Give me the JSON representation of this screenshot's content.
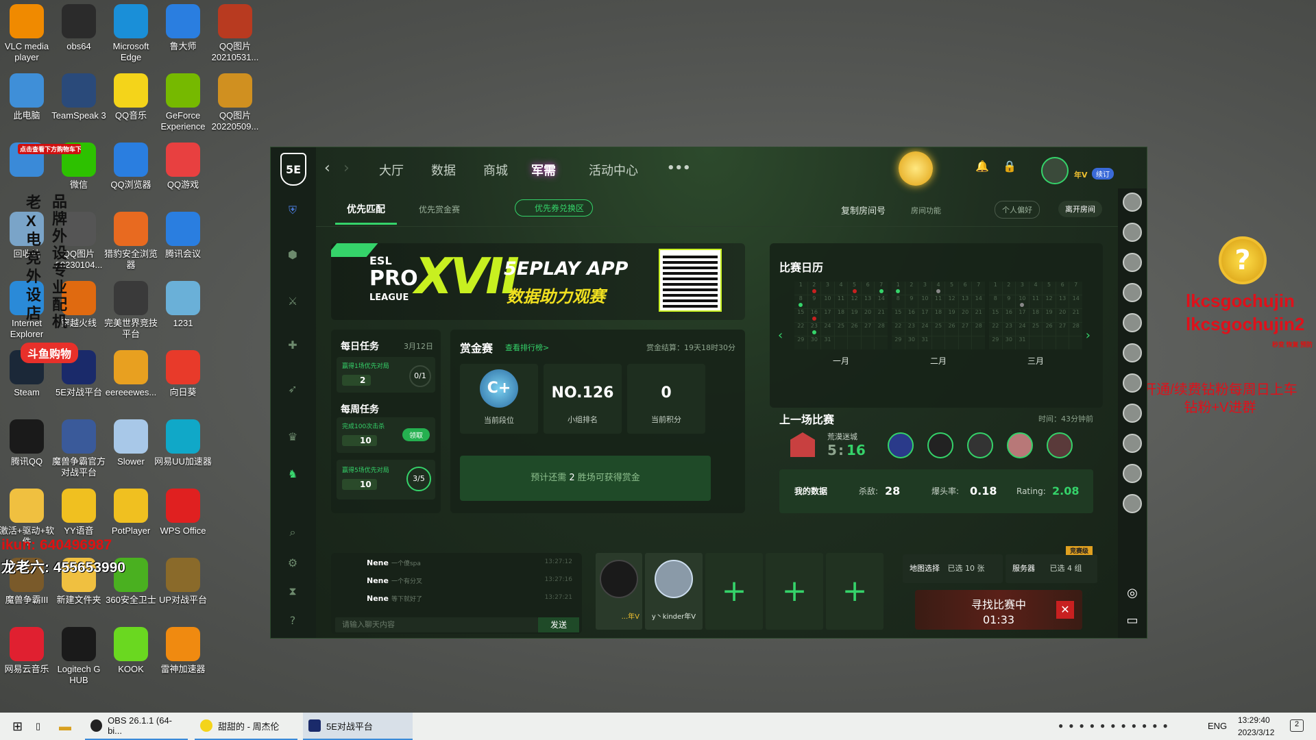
{
  "desktop_icons": [
    {
      "label": "VLC media player",
      "icon": "vlc-icon",
      "color": "#f08a00",
      "col": 0,
      "row": 0
    },
    {
      "label": "obs64",
      "icon": "obs-icon",
      "color": "#2b2b2b",
      "col": 1,
      "row": 0
    },
    {
      "label": "Microsoft Edge",
      "icon": "edge-icon",
      "color": "#1a8fd8",
      "col": 2,
      "row": 0
    },
    {
      "label": "鲁大师",
      "icon": "ludashi-icon",
      "color": "#2a7ee0",
      "col": 3,
      "row": 0
    },
    {
      "label": "QQ图片20210531...",
      "icon": "image-file-icon",
      "color": "#b83a20",
      "col": 4,
      "row": 0
    },
    {
      "label": "此电脑",
      "icon": "computer-icon",
      "color": "#3f8fd8",
      "col": 0,
      "row": 1
    },
    {
      "label": "TeamSpeak 3",
      "icon": "teamspeak-icon",
      "color": "#2a4a7a",
      "col": 1,
      "row": 1
    },
    {
      "label": "QQ音乐",
      "icon": "qqmusic-icon",
      "color": "#f4d41a",
      "col": 2,
      "row": 1
    },
    {
      "label": "GeForce Experience",
      "icon": "nvidia-icon",
      "color": "#76b900",
      "col": 3,
      "row": 1
    },
    {
      "label": "QQ图片20220509...",
      "icon": "image-file-icon",
      "color": "#d09020",
      "col": 4,
      "row": 1
    },
    {
      "label": "",
      "icon": "network-icon",
      "color": "#3a8ad8",
      "col": 0,
      "row": 2
    },
    {
      "label": "微信",
      "icon": "wechat-icon",
      "color": "#2dc100",
      "col": 1,
      "row": 2
    },
    {
      "label": "QQ浏览器",
      "icon": "qqbrowser-icon",
      "color": "#2a7ee0",
      "col": 2,
      "row": 2
    },
    {
      "label": "QQ游戏",
      "icon": "qqgame-icon",
      "color": "#e84040",
      "col": 3,
      "row": 2
    },
    {
      "label": "回收站",
      "icon": "recycle-bin-icon",
      "color": "#7aa4c8",
      "col": 0,
      "row": 3
    },
    {
      "label": "QQ图片20230104...",
      "icon": "image-file-icon",
      "color": "#555555",
      "col": 1,
      "row": 3
    },
    {
      "label": "猎豹安全浏览器",
      "icon": "liebao-icon",
      "color": "#e86a20",
      "col": 2,
      "row": 3
    },
    {
      "label": "腾讯会议",
      "icon": "tencent-meeting-icon",
      "color": "#2a7ee0",
      "col": 3,
      "row": 3
    },
    {
      "label": "Internet Explorer",
      "icon": "ie-icon",
      "color": "#2a8ad8",
      "col": 0,
      "row": 4
    },
    {
      "label": "穿越火线",
      "icon": "crossfire-icon",
      "color": "#e06a10",
      "col": 1,
      "row": 4
    },
    {
      "label": "完美世界竞技平台",
      "icon": "perfect-world-icon",
      "color": "#3a3a3a",
      "col": 2,
      "row": 4
    },
    {
      "label": "1231",
      "icon": "file-icon",
      "color": "#6ab0d8",
      "col": 3,
      "row": 4
    },
    {
      "label": "Steam",
      "icon": "steam-icon",
      "color": "#1b2838",
      "col": 0,
      "row": 5
    },
    {
      "label": "5E对战平台",
      "icon": "5e-icon",
      "color": "#1a2a6a",
      "col": 1,
      "row": 5
    },
    {
      "label": "eereeewes...",
      "icon": "gamepad-icon",
      "color": "#e8a020",
      "col": 2,
      "row": 5
    },
    {
      "label": "向日葵",
      "icon": "sunflower-icon",
      "color": "#e83a2a",
      "col": 3,
      "row": 5
    },
    {
      "label": "腾讯QQ",
      "icon": "qq-icon",
      "color": "#1a1a1a",
      "col": 0,
      "row": 6
    },
    {
      "label": "魔兽争霸官方对战平台",
      "icon": "warcraft-icon",
      "color": "#3a5a9a",
      "col": 1,
      "row": 6
    },
    {
      "label": "Slower",
      "icon": "slower-icon",
      "color": "#a8c8e8",
      "col": 2,
      "row": 6
    },
    {
      "label": "网易UU加速器",
      "icon": "uu-icon",
      "color": "#10a8c8",
      "col": 3,
      "row": 6
    },
    {
      "label": "激活+驱动+软件",
      "icon": "folder-icon",
      "color": "#f0c040",
      "col": 0,
      "row": 7
    },
    {
      "label": "YY语音",
      "icon": "yy-icon",
      "color": "#f0c020",
      "col": 1,
      "row": 7
    },
    {
      "label": "PotPlayer",
      "icon": "potplayer-icon",
      "color": "#f0c020",
      "col": 2,
      "row": 7
    },
    {
      "label": "WPS Office",
      "icon": "wps-icon",
      "color": "#e02020",
      "col": 3,
      "row": 7
    },
    {
      "label": "魔兽争霸III",
      "icon": "warcraft3-icon",
      "color": "#7a5a2a",
      "col": 0,
      "row": 8
    },
    {
      "label": "新建文件夹",
      "icon": "folder-icon",
      "color": "#f0c040",
      "col": 1,
      "row": 8
    },
    {
      "label": "360安全卫士",
      "icon": "360-icon",
      "color": "#4ab020",
      "col": 2,
      "row": 8
    },
    {
      "label": "UP对战平台",
      "icon": "up-icon",
      "color": "#8a6a2a",
      "col": 3,
      "row": 8
    },
    {
      "label": "网易云音乐",
      "icon": "netease-music-icon",
      "color": "#e02030",
      "col": 0,
      "row": 9
    },
    {
      "label": "Logitech G HUB",
      "icon": "logitech-icon",
      "color": "#1a1a1a",
      "col": 1,
      "row": 9
    },
    {
      "label": "KOOK",
      "icon": "kook-icon",
      "color": "#6ad820",
      "col": 2,
      "row": 9
    },
    {
      "label": "雷神加速器",
      "icon": "leishen-icon",
      "color": "#f08a10",
      "col": 3,
      "row": 9
    }
  ],
  "overlay": {
    "vertical_left": "老X电竞外设店",
    "vertical_right": "品牌外设专业配机",
    "shop_banner": "斗鱼购物",
    "ikun": "ikun: 640496987",
    "long": "龙老六: 455653990",
    "red_note": "点击查看下方购物车下单",
    "right_name1": "lkcsgochujin",
    "right_name2": "lkcsgochujin2",
    "right_small": "秒变 恢复 预防",
    "right_promo": "开通/续费钻粉每周日上车\n钻粉+V进群"
  },
  "app": {
    "nav": {
      "hall": "大厅",
      "data": "数据",
      "shop": "商城",
      "junxu": "军需",
      "activity": "活动中心",
      "more": "•••",
      "badge_user": "年V",
      "renew": "续订"
    },
    "subnav": {
      "tab1": "优先匹配",
      "tab2": "优先赏金赛",
      "coupon": "优先券兑换区",
      "copy_room": "复制房间号",
      "room_func": "房间功能",
      "pref": "个人偏好",
      "leave": "离开房间"
    },
    "banner": {
      "esl": "ESL",
      "pro": "PRO",
      "league": "LEAGUE",
      "xvii": "XVII",
      "line1": "5EPLAY APP",
      "line2": "数据助力观赛"
    },
    "tasks": {
      "daily_title": "每日任务",
      "date": "3月12日",
      "daily_desc": "赢得1场优先对局",
      "daily_reward": "2",
      "daily_progress": "0/1",
      "weekly_title": "每周任务",
      "w1_desc": "完成100次击杀",
      "w1_reward": "10",
      "w1_btn": "领取",
      "w2_desc": "赢得5场优先对局",
      "w2_reward": "10",
      "w2_progress": "3/5"
    },
    "bounty": {
      "title": "赏金赛",
      "rank_link": "查看排行榜>",
      "settle": "赏金结算：19天18时30分",
      "rank_label": "当前段位",
      "rank_icon": "C+",
      "group_rank": "NO.126",
      "group_label": "小组排名",
      "points": "0",
      "points_label": "当前积分",
      "hint_pre": "预计还需",
      "hint_num": "2",
      "hint_post": "胜场可获得赏金"
    },
    "calendar": {
      "title": "比赛日历",
      "months": [
        "一月",
        "二月",
        "三月"
      ]
    },
    "last": {
      "title": "上一场比赛",
      "time": "时间：43分钟前",
      "map": "荒漠迷城",
      "score_a": "5",
      "score_b": "16",
      "my_data": "我的数据",
      "kills_label": "杀敌:",
      "kills": "28",
      "hs_label": "爆头率:",
      "hs": "0.18",
      "rating_label": "Rating:",
      "rating": "2.08"
    },
    "chat": {
      "rows": [
        {
          "name": "Nene",
          "msg": "一个傻spa",
          "time": "13:27:12"
        },
        {
          "name": "Nene",
          "msg": "一个有分叉",
          "time": "13:27:16"
        },
        {
          "name": "Nene",
          "msg": "等下就好了",
          "time": "13:27:21"
        }
      ],
      "placeholder": "请输入聊天内容",
      "send": "发送"
    },
    "party": {
      "p1": "...年V",
      "p2": "y丶kinder年V"
    },
    "match": {
      "map_label": "地图选择",
      "map_val": "已选 10 张",
      "server_label": "服务器",
      "server_val": "已选 4 组",
      "tier": "竞赛级",
      "searching": "寻找比赛中",
      "timer": "01:33"
    }
  },
  "taskbar": {
    "obs": "OBS 26.1.1 (64-bi...",
    "music": "甜甜的 - 周杰伦",
    "app": "5E对战平台",
    "lang": "ENG",
    "time": "13:29:40",
    "date": "2023/3/12",
    "notif": "2"
  }
}
